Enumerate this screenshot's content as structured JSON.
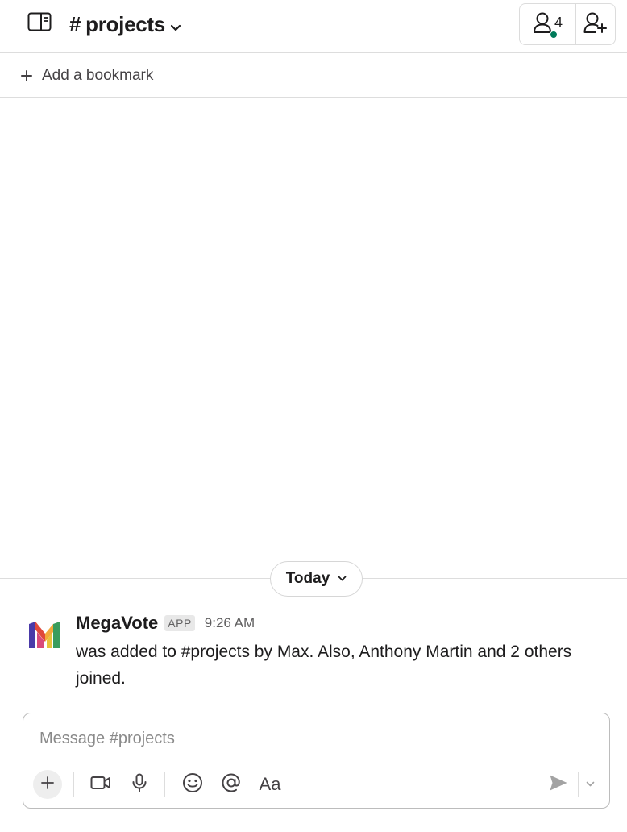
{
  "header": {
    "channel_hash": "#",
    "channel_name": "projects",
    "member_count": "4"
  },
  "bookmarks": {
    "add_label": "Add a bookmark"
  },
  "divider": {
    "label": "Today"
  },
  "messages": [
    {
      "sender": "MegaVote",
      "badge": "APP",
      "time": "9:26 AM",
      "text": "was added to #projects by Max. Also, Anthony Martin and 2 others joined."
    }
  ],
  "composer": {
    "placeholder": "Message #projects",
    "format_label": "Aa"
  },
  "colors": {
    "online_dot": "#007a5a",
    "avatar_bars": [
      "#4a3aa8",
      "#e0493b",
      "#f2a93b",
      "#3a9d5d"
    ]
  }
}
